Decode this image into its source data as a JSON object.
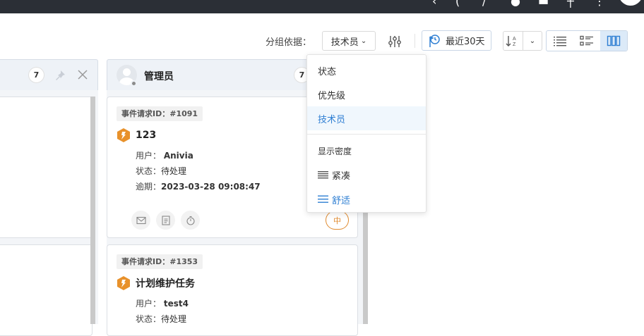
{
  "toolbar": {
    "group_by_label": "分组依据：",
    "group_by_value": "技术员",
    "date_filter": "最近30天",
    "sort_label": "A Z"
  },
  "columns": [
    {
      "count": "7"
    },
    {
      "title": "管理员",
      "count": "7"
    }
  ],
  "cards": [
    {
      "id_label": "事件请求ID：",
      "id_value": "#1091",
      "title": "123",
      "user_key": "用户：",
      "user_value": "Anivia",
      "status_key": "状态：",
      "status_value": "待处理",
      "due_key": "逾期：",
      "due_value": "2023-03-28 09:08:47",
      "priority": "中"
    },
    {
      "id_label": "事件请求ID：",
      "id_value": "#1353",
      "title": "计划维护任务",
      "user_key": "用户：",
      "user_value": "test4",
      "status_key": "状态：",
      "status_value": "待处理"
    }
  ],
  "dropdown": {
    "items": [
      "状态",
      "优先级",
      "技术员"
    ],
    "selected": "技术员",
    "section_title": "显示密度",
    "density_options": [
      "紧凑",
      "舒适"
    ],
    "density_selected": "舒适"
  },
  "colors": {
    "accent": "#2f7fd3",
    "priority_orange": "#e08a2e",
    "incident_icon": "#e8912b",
    "topbar": "#2b2f36"
  },
  "icons": {
    "filter": "sliders-icon",
    "date": "clock-flag-icon",
    "sort": "sort-az-icon",
    "views": [
      "list-icon",
      "detail-list-icon",
      "kanban-icon"
    ],
    "card_actions": [
      "mail-icon",
      "note-icon",
      "timer-icon"
    ]
  }
}
